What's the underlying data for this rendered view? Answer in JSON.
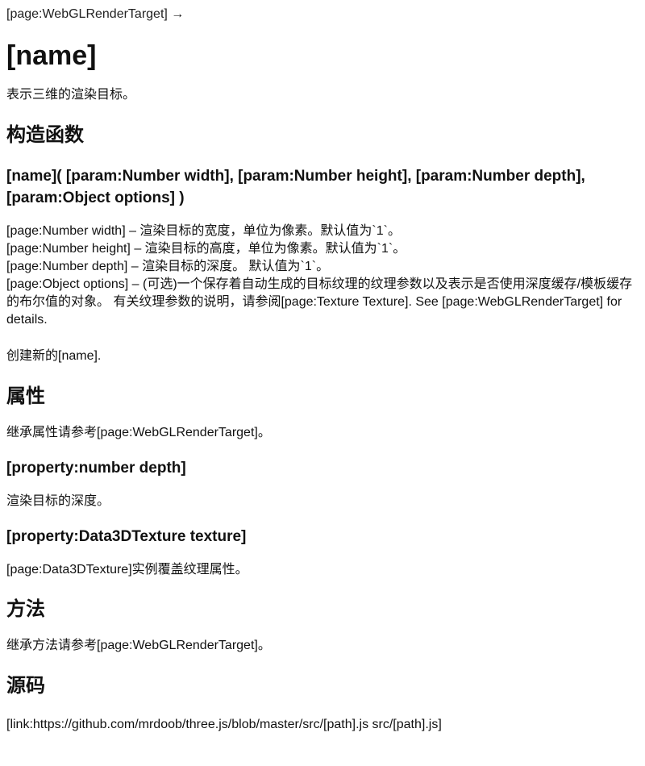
{
  "breadcrumb": "[page:WebGLRenderTarget] →",
  "title": "[name]",
  "intro": "表示三维的渲染目标。",
  "constructor": {
    "heading": "构造函数",
    "signature": "[name]( [param:Number width], [param:Number height], [param:Number depth], [param:Object options] )",
    "params": [
      "[page:Number width] – 渲染目标的宽度，单位为像素。默认值为`1`。",
      "[page:Number height] – 渲染目标的高度，单位为像素。默认值为`1`。",
      "[page:Number depth] – 渲染目标的深度。 默认值为`1`。",
      "[page:Object options] – (可选)一个保存着自动生成的目标纹理的纹理参数以及表示是否使用深度缓存/模板缓存的布尔值的对象。 有关纹理参数的说明，请参阅[page:Texture Texture]. See [page:WebGLRenderTarget] for details."
    ],
    "creates": "创建新的[name]."
  },
  "properties": {
    "heading": "属性",
    "inherit": "继承属性请参考[page:WebGLRenderTarget]。",
    "depth": {
      "heading": "[property:number depth]",
      "description": "渲染目标的深度。"
    },
    "texture": {
      "heading": "[property:Data3DTexture texture]",
      "description": "[page:Data3DTexture]实例覆盖纹理属性。"
    }
  },
  "methods": {
    "heading": "方法",
    "inherit": "继承方法请参考[page:WebGLRenderTarget]。"
  },
  "source": {
    "heading": "源码",
    "link": "[link:https://github.com/mrdoob/three.js/blob/master/src/[path].js src/[path].js]"
  }
}
